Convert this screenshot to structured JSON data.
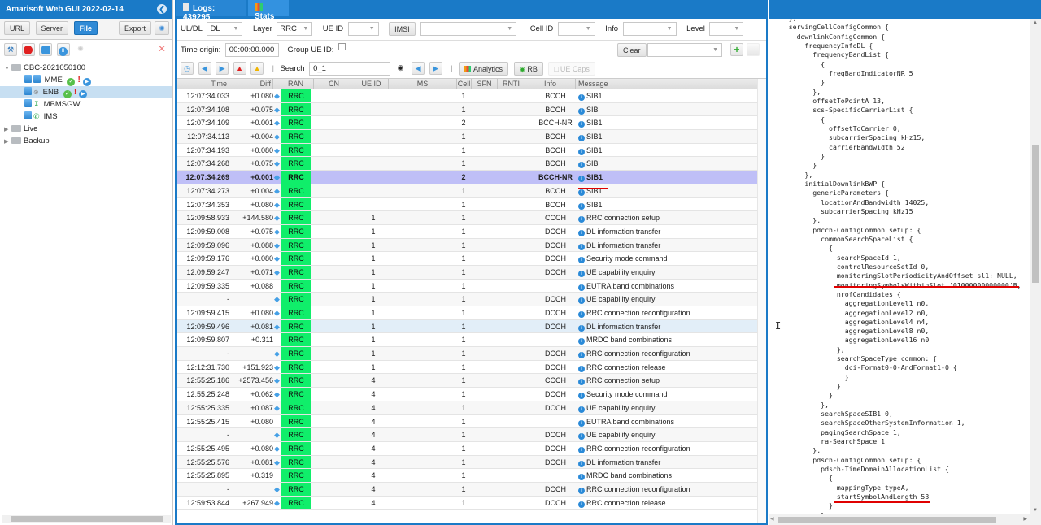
{
  "app": {
    "title": "Amarisoft Web GUI 2022-02-14"
  },
  "sidebar": {
    "buttons": {
      "url": "URL",
      "server": "Server",
      "file": "File",
      "export": "Export"
    },
    "tree": {
      "root": "CBC-2021050100",
      "nodes": [
        {
          "label": "MME",
          "status": "ok"
        },
        {
          "label": "ENB",
          "status": "ok",
          "selected": true
        },
        {
          "label": "MBMSGW"
        },
        {
          "label": "IMS"
        }
      ],
      "folders": [
        "Live",
        "Backup"
      ]
    }
  },
  "tabs": [
    {
      "label": "Logs: 439295",
      "icon": "document-icon"
    },
    {
      "label": "Stats",
      "icon": "bar-chart-icon"
    }
  ],
  "filters": {
    "uldl_label": "UL/DL",
    "uldl_value": "DL",
    "layer_label": "Layer",
    "layer_value": "RRC",
    "ueid_label": "UE ID",
    "ueid_value": "",
    "imsi_button": "IMSI",
    "imsi_value": "",
    "cellid_label": "Cell ID",
    "cellid_value": "",
    "info_label": "Info",
    "info_value": "",
    "level_label": "Level",
    "level_value": ""
  },
  "timebar": {
    "time_origin_label": "Time origin:",
    "time_origin_value": "00:00:00.000",
    "group_ueid_label": "Group UE ID:",
    "clear_button": "Clear",
    "preset_value": ""
  },
  "toolbar": {
    "search_label": "Search",
    "search_value": "0_1",
    "analytics_button": "Analytics",
    "rb_button": "RB",
    "uecaps_button": "UE Caps"
  },
  "table": {
    "columns": [
      "Time",
      "Diff",
      "RAN",
      "CN",
      "UE ID",
      "IMSI",
      "Cell",
      "SFN",
      "RNTI",
      "Info",
      "Message"
    ],
    "rows": [
      {
        "time": "12:07:34.033",
        "diff": "+0.080",
        "arrow": true,
        "ran": "RRC",
        "ue_id": "",
        "cell": "1",
        "info": "BCCH",
        "message": "SIB1"
      },
      {
        "time": "12:07:34.108",
        "diff": "+0.075",
        "arrow": true,
        "ran": "RRC",
        "ue_id": "",
        "cell": "1",
        "info": "BCCH",
        "message": "SIB"
      },
      {
        "time": "12:07:34.109",
        "diff": "+0.001",
        "arrow": true,
        "ran": "RRC",
        "ue_id": "",
        "cell": "2",
        "info": "BCCH-NR",
        "message": "SIB1"
      },
      {
        "time": "12:07:34.113",
        "diff": "+0.004",
        "arrow": true,
        "ran": "RRC",
        "ue_id": "",
        "cell": "1",
        "info": "BCCH",
        "message": "SIB1"
      },
      {
        "time": "12:07:34.193",
        "diff": "+0.080",
        "arrow": true,
        "ran": "RRC",
        "ue_id": "",
        "cell": "1",
        "info": "BCCH",
        "message": "SIB1"
      },
      {
        "time": "12:07:34.268",
        "diff": "+0.075",
        "arrow": true,
        "ran": "RRC",
        "ue_id": "",
        "cell": "1",
        "info": "BCCH",
        "message": "SIB"
      },
      {
        "time": "12:07:34.269",
        "diff": "+0.001",
        "arrow": true,
        "ran": "RRC",
        "ue_id": "",
        "cell": "2",
        "info": "BCCH-NR",
        "message": "SIB1",
        "selected": true
      },
      {
        "time": "12:07:34.273",
        "diff": "+0.004",
        "arrow": true,
        "ran": "RRC",
        "ue_id": "",
        "cell": "1",
        "info": "BCCH",
        "message": "SIB1"
      },
      {
        "time": "12:07:34.353",
        "diff": "+0.080",
        "arrow": true,
        "ran": "RRC",
        "ue_id": "",
        "cell": "1",
        "info": "BCCH",
        "message": "SIB1"
      },
      {
        "time": "12:09:58.933",
        "diff": "+144.580",
        "arrow": true,
        "ran": "RRC",
        "ue_id": "1",
        "cell": "1",
        "info": "CCCH",
        "message": "RRC connection setup"
      },
      {
        "time": "12:09:59.008",
        "diff": "+0.075",
        "arrow": true,
        "ran": "RRC",
        "ue_id": "1",
        "cell": "1",
        "info": "DCCH",
        "message": "DL information transfer"
      },
      {
        "time": "12:09:59.096",
        "diff": "+0.088",
        "arrow": true,
        "ran": "RRC",
        "ue_id": "1",
        "cell": "1",
        "info": "DCCH",
        "message": "DL information transfer"
      },
      {
        "time": "12:09:59.176",
        "diff": "+0.080",
        "arrow": true,
        "ran": "RRC",
        "ue_id": "1",
        "cell": "1",
        "info": "DCCH",
        "message": "Security mode command"
      },
      {
        "time": "12:09:59.247",
        "diff": "+0.071",
        "arrow": true,
        "ran": "RRC",
        "ue_id": "1",
        "cell": "1",
        "info": "DCCH",
        "message": "UE capability enquiry"
      },
      {
        "time": "12:09:59.335",
        "diff": "+0.088",
        "arrow": false,
        "ran": "RRC",
        "ue_id": "1",
        "cell": "1",
        "info": "",
        "message": "EUTRA band combinations"
      },
      {
        "time": "-",
        "diff": "",
        "arrow": true,
        "ran": "RRC",
        "ue_id": "1",
        "cell": "1",
        "info": "DCCH",
        "message": "UE capability enquiry"
      },
      {
        "time": "12:09:59.415",
        "diff": "+0.080",
        "arrow": true,
        "ran": "RRC",
        "ue_id": "1",
        "cell": "1",
        "info": "DCCH",
        "message": "RRC connection reconfiguration"
      },
      {
        "time": "12:09:59.496",
        "diff": "+0.081",
        "arrow": true,
        "ran": "RRC",
        "ue_id": "1",
        "cell": "1",
        "info": "DCCH",
        "message": "DL information transfer",
        "hover": true
      },
      {
        "time": "12:09:59.807",
        "diff": "+0.311",
        "arrow": false,
        "ran": "RRC",
        "ue_id": "1",
        "cell": "1",
        "info": "",
        "message": "MRDC band combinations"
      },
      {
        "time": "-",
        "diff": "",
        "arrow": true,
        "ran": "RRC",
        "ue_id": "1",
        "cell": "1",
        "info": "DCCH",
        "message": "RRC connection reconfiguration"
      },
      {
        "time": "12:12:31.730",
        "diff": "+151.923",
        "arrow": true,
        "ran": "RRC",
        "ue_id": "1",
        "cell": "1",
        "info": "DCCH",
        "message": "RRC connection release"
      },
      {
        "time": "12:55:25.186",
        "diff": "+2573.456",
        "arrow": true,
        "ran": "RRC",
        "ue_id": "4",
        "cell": "1",
        "info": "CCCH",
        "message": "RRC connection setup"
      },
      {
        "time": "12:55:25.248",
        "diff": "+0.062",
        "arrow": true,
        "ran": "RRC",
        "ue_id": "4",
        "cell": "1",
        "info": "DCCH",
        "message": "Security mode command"
      },
      {
        "time": "12:55:25.335",
        "diff": "+0.087",
        "arrow": true,
        "ran": "RRC",
        "ue_id": "4",
        "cell": "1",
        "info": "DCCH",
        "message": "UE capability enquiry"
      },
      {
        "time": "12:55:25.415",
        "diff": "+0.080",
        "arrow": false,
        "ran": "RRC",
        "ue_id": "4",
        "cell": "1",
        "info": "",
        "message": "EUTRA band combinations"
      },
      {
        "time": "-",
        "diff": "",
        "arrow": true,
        "ran": "RRC",
        "ue_id": "4",
        "cell": "1",
        "info": "DCCH",
        "message": "UE capability enquiry"
      },
      {
        "time": "12:55:25.495",
        "diff": "+0.080",
        "arrow": true,
        "ran": "RRC",
        "ue_id": "4",
        "cell": "1",
        "info": "DCCH",
        "message": "RRC connection reconfiguration"
      },
      {
        "time": "12:55:25.576",
        "diff": "+0.081",
        "arrow": true,
        "ran": "RRC",
        "ue_id": "4",
        "cell": "1",
        "info": "DCCH",
        "message": "DL information transfer"
      },
      {
        "time": "12:55:25.895",
        "diff": "+0.319",
        "arrow": false,
        "ran": "RRC",
        "ue_id": "4",
        "cell": "1",
        "info": "",
        "message": "MRDC band combinations"
      },
      {
        "time": "-",
        "diff": "",
        "arrow": true,
        "ran": "RRC",
        "ue_id": "4",
        "cell": "1",
        "info": "DCCH",
        "message": "RRC connection reconfiguration"
      },
      {
        "time": "12:59:53.844",
        "diff": "+267.949",
        "arrow": true,
        "ran": "RRC",
        "ue_id": "4",
        "cell": "1",
        "info": "DCCH",
        "message": "RRC connection release"
      }
    ]
  },
  "code_panel": {
    "lines": [
      "    },",
      "    servingCellConfigCommon {",
      "      downlinkConfigCommon {",
      "        frequencyInfoDL {",
      "          frequencyBandList {",
      "            {",
      "              freqBandIndicatorNR 5",
      "            }",
      "          },",
      "          offsetToPointA 13,",
      "          scs-SpecificCarrierList {",
      "            {",
      "              offsetToCarrier 0,",
      "              subcarrierSpacing kHz15,",
      "              carrierBandwidth 52",
      "            }",
      "          }",
      "        },",
      "        initialDownlinkBWP {",
      "          genericParameters {",
      "            locationAndBandwidth 14025,",
      "            subcarrierSpacing kHz15",
      "          },",
      "          pdcch-ConfigCommon setup: {",
      "            commonSearchSpaceList {",
      "              {",
      "                searchSpaceId 1,",
      "                controlResourceSetId 0,",
      "                monitoringSlotPeriodicityAndOffset sl1: NULL,",
      "                monitoringSymbolsWithinSlot '01000000000000'B,",
      "                nrofCandidates {",
      "                  aggregationLevel1 n0,",
      "                  aggregationLevel2 n0,",
      "                  aggregationLevel4 n4,",
      "                  aggregationLevel8 n0,",
      "                  aggregationLevel16 n0",
      "                },",
      "                searchSpaceType common: {",
      "                  dci-Format0-0-AndFormat1-0 {",
      "                  }",
      "                }",
      "              }",
      "            },",
      "            searchSpaceSIB1 0,",
      "            searchSpaceOtherSystemInformation 1,",
      "            pagingSearchSpace 1,",
      "            ra-SearchSpace 1",
      "          },",
      "          pdsch-ConfigCommon setup: {",
      "            pdsch-TimeDomainAllocationList {",
      "              {",
      "                mappingType typeA,",
      "                startSymbolAndLength 53",
      "              }",
      "            },"
    ]
  },
  "colors": {
    "brand_blue": "#1a7ac7",
    "ran_green": "#10ee6a",
    "selected_row": "#bfbff7",
    "highlight_red": "#e00000"
  }
}
